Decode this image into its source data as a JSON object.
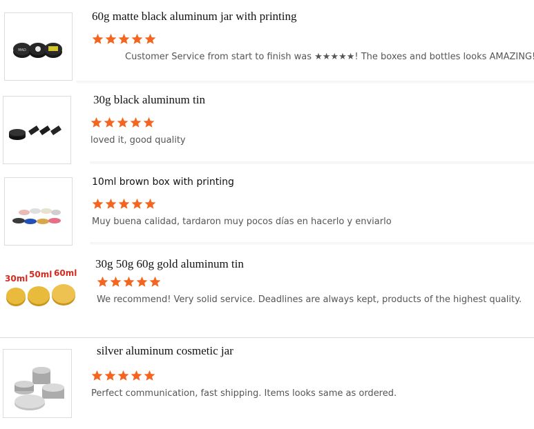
{
  "accent_color": "#f4651f",
  "reviews": [
    {
      "product_title": "60g matte black aluminum jar with printing",
      "rating": 5,
      "comment": "Customer Service from start to finish was ★★★★★! The boxes and bottles looks AMAZING!",
      "thumbnail": "black-jars-with-printing-image"
    },
    {
      "product_title": "30g black aluminum tin",
      "rating": 5,
      "comment": "loved it, good quality",
      "thumbnail": "black-tins-image"
    },
    {
      "product_title": "10ml brown box with printing",
      "rating": 5,
      "comment": "Muy buena calidad, tardaron muy pocos días en hacerlo y enviarlo",
      "thumbnail": "colored-tins-image"
    },
    {
      "product_title": "30g 50g 60g gold aluminum tin",
      "rating": 5,
      "comment": "We recommend! Very solid service. Deadlines are always kept, products of the highest quality.",
      "thumbnail": "gold-tins-image",
      "image_labels": [
        "30ml",
        "50ml",
        "60ml"
      ]
    },
    {
      "product_title": "silver aluminum cosmetic jar",
      "rating": 5,
      "comment": "Perfect communication, fast shipping. Items looks same as ordered.",
      "thumbnail": "silver-jars-image"
    }
  ]
}
